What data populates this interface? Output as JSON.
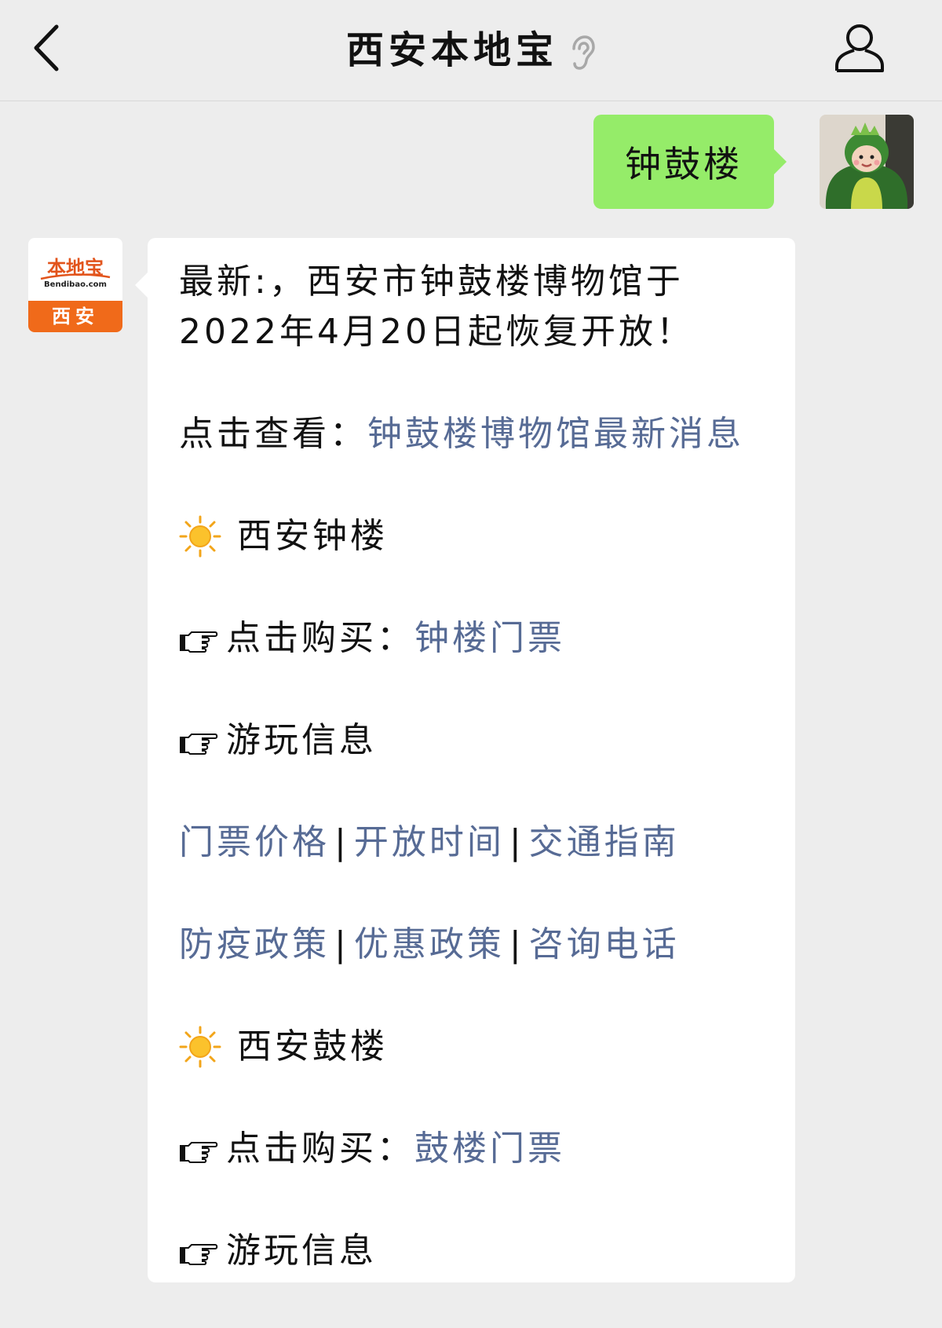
{
  "header": {
    "title": "西安本地宝",
    "back_icon": "chevron-left-icon",
    "ear_icon": "ear-icon",
    "profile_icon": "person-icon"
  },
  "outgoing_message": {
    "text": "钟鼓楼"
  },
  "bot_avatar": {
    "name": "本地宝",
    "domain": "Bendibao.com",
    "city": "西安"
  },
  "incoming_message": {
    "headline": "最新:，西安市钟鼓楼博物馆于2022年4月20日起恢复开放！",
    "view_prefix": "点击查看：",
    "view_link": "钟鼓楼博物馆最新消息",
    "bell_tower": {
      "heading": "西安钟楼",
      "buy_prefix": "点击购买：",
      "buy_link": "钟楼门票",
      "info_label": "游玩信息",
      "links_row1": [
        "门票价格",
        "开放时间",
        "交通指南"
      ],
      "links_row2": [
        "防疫政策",
        "优惠政策",
        "咨询电话"
      ]
    },
    "drum_tower": {
      "heading": "西安鼓楼",
      "buy_prefix": "点击购买：",
      "buy_link": "鼓楼门票",
      "info_label": "游玩信息"
    },
    "separator": "|"
  },
  "colors": {
    "background": "#ededed",
    "outgoing_bubble": "#95ec69",
    "incoming_bubble": "#ffffff",
    "link": "#576b95",
    "logo_orange": "#f06a1a"
  }
}
